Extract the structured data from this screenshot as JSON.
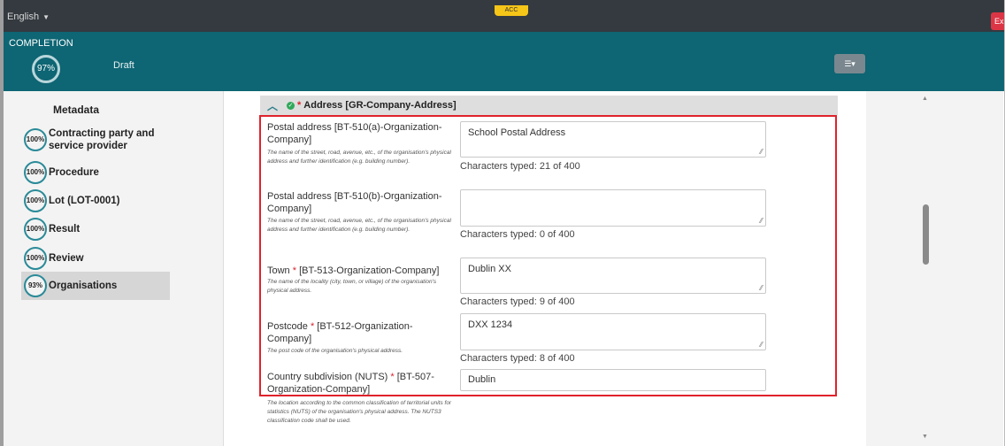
{
  "topbar": {
    "language": "English",
    "env_badge": "ACC",
    "exit_label": "Exit"
  },
  "progress": {
    "completion_label": "COMPLETION",
    "percent": "97%",
    "status": "Draft"
  },
  "sidebar": {
    "title": "Metadata",
    "items": [
      {
        "pct": "100%",
        "label": "Contracting party and service provider"
      },
      {
        "pct": "100%",
        "label": "Procedure"
      },
      {
        "pct": "100%",
        "label": "Lot (LOT-0001)"
      },
      {
        "pct": "100%",
        "label": "Result"
      },
      {
        "pct": "100%",
        "label": "Review"
      },
      {
        "pct": "93%",
        "label": "Organisations"
      }
    ]
  },
  "section": {
    "required_mark": "*",
    "title": "Address  [GR-Company-Address]"
  },
  "fields": [
    {
      "label": "Postal address [BT-510(a)-Organization-Company]",
      "required": "",
      "desc": "The name of the street, road, avenue, etc., of the organisation's physical address and further identification (e.g. building number).",
      "value": "School Postal Address",
      "counter": "Characters typed: 21 of 400"
    },
    {
      "label": "Postal address [BT-510(b)-Organization-Company]",
      "required": "",
      "desc": "The name of the street, road, avenue, etc., of the organisation's physical address and further identification (e.g. building number).",
      "value": "",
      "counter": "Characters typed: 0 of 400"
    },
    {
      "label": "Town",
      "required": "*",
      "label_rest": "[BT-513-Organization-Company]",
      "desc": "The name of the locality (city, town, or village) of the organisation's physical address.",
      "value": "Dublin XX",
      "counter": "Characters typed: 9 of 400"
    },
    {
      "label": "Postcode",
      "required": "*",
      "label_rest": "[BT-512-Organization-Company]",
      "desc": "The post code of the organisation's physical address.",
      "value": "DXX 1234",
      "counter": "Characters typed: 8 of 400"
    },
    {
      "label": "Country subdivision (NUTS)",
      "required": "*",
      "label_rest": "[BT-507-Organization-Company]",
      "desc": "The location according to the common classification of territorial units for statistics (NUTS) of the organisation's physical address. The NUTS3 classification code shall be used.",
      "value": "Dublin"
    }
  ],
  "colors": {
    "topbar": "#343a40",
    "progress_bg": "#0e6573",
    "highlight": "#e0222c",
    "required": "#d9232d",
    "exit": "#dc3545",
    "badge": "#f5c518"
  }
}
